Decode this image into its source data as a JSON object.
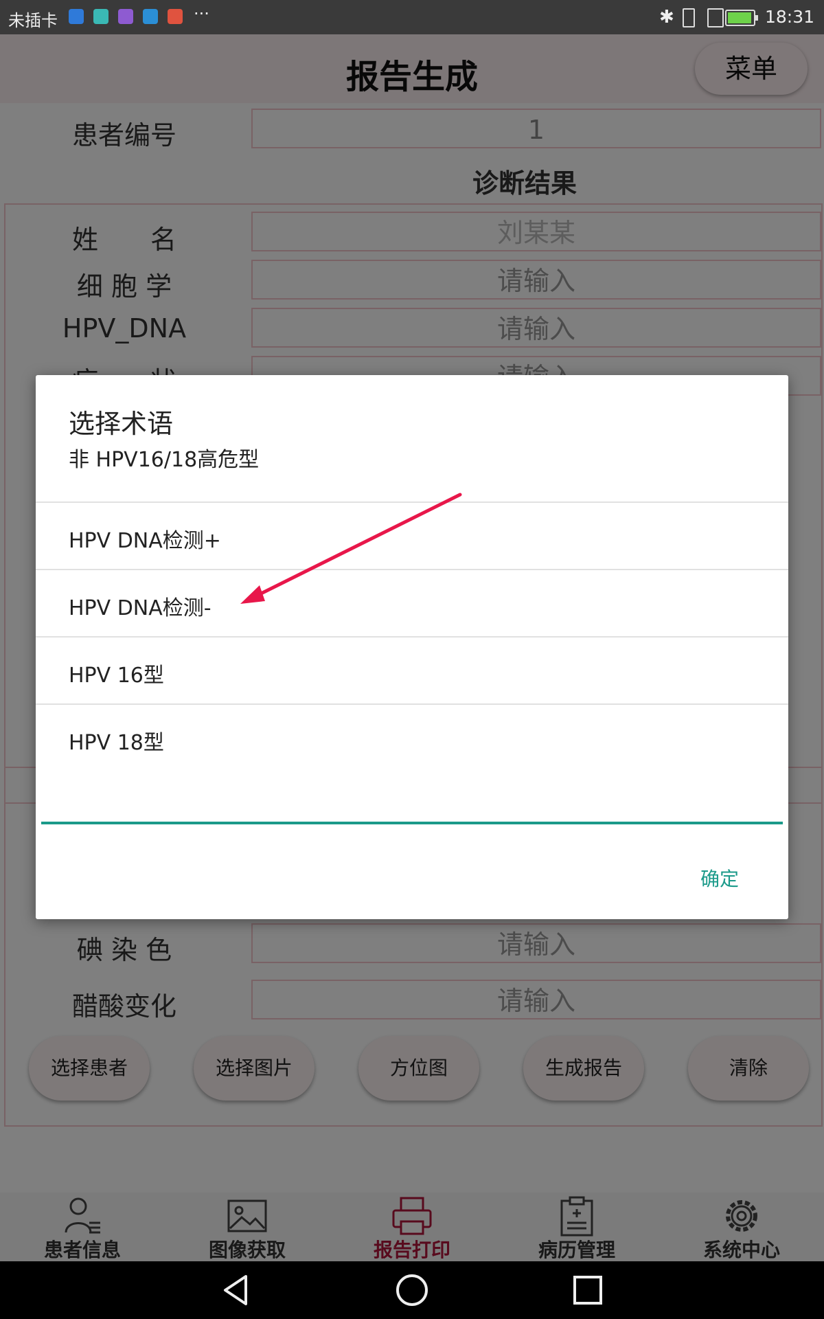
{
  "status_bar": {
    "carrier": "未插卡",
    "more": "···",
    "time": "18:31",
    "icons": [
      "app-icon-blue",
      "app-icon-cyan",
      "app-icon-purple",
      "app-icon-shield",
      "app-icon-red",
      "bluetooth-icon",
      "vibrate-icon",
      "sim-icon",
      "battery-icon"
    ],
    "battery_level": 0.95
  },
  "header": {
    "title": "报告生成",
    "menu_label": "菜单"
  },
  "form": {
    "patient_id_label": "患者编号",
    "patient_id_value": "1",
    "section_title": "诊断结果",
    "rows": [
      {
        "label": "姓　　名",
        "value": "刘某某"
      },
      {
        "label": "细 胞 学",
        "value": "请输入"
      },
      {
        "label": "HPV_DNA",
        "value": "请输入"
      },
      {
        "label": "症　　状",
        "value": "请输入"
      }
    ],
    "bottom_rows": [
      {
        "label": "碘 染 色",
        "value": "请输入"
      },
      {
        "label": "醋酸变化",
        "value": "请输入"
      }
    ]
  },
  "buttons": [
    "选择患者",
    "选择图片",
    "方位图",
    "生成报告",
    "清除"
  ],
  "tabs": [
    {
      "label": "患者信息",
      "icon": "person-list-icon",
      "active": false
    },
    {
      "label": "图像获取",
      "icon": "image-icon",
      "active": false
    },
    {
      "label": "报告打印",
      "icon": "printer-icon",
      "active": true
    },
    {
      "label": "病历管理",
      "icon": "clipboard-icon",
      "active": false
    },
    {
      "label": "系统中心",
      "icon": "gear-icon",
      "active": false
    }
  ],
  "dialog": {
    "title": "选择术语",
    "options": [
      "非 HPV16/18高危型",
      "HPV DNA检测+",
      "HPV DNA检测-",
      "HPV 16型",
      "HPV 18型"
    ],
    "confirm": "确定"
  },
  "colors": {
    "accent": "#1b9a8a",
    "active_tab": "#b0153a",
    "field_border": "#f2c5ca",
    "annotation_arrow": "#e8174a"
  }
}
